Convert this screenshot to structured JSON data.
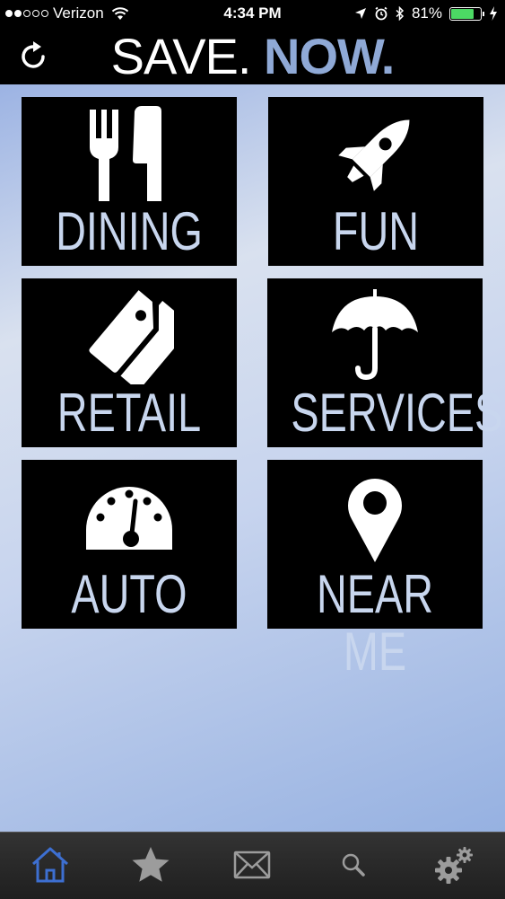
{
  "status_bar": {
    "carrier": "Verizon",
    "time": "4:34 PM",
    "battery_percent": "81%",
    "battery_level": 0.81,
    "signal_bars": 2
  },
  "header": {
    "brand_part1": "SAVE.",
    "brand_part2": "NOW."
  },
  "tiles": [
    {
      "label": "DINING",
      "icon": "fork-knife-icon"
    },
    {
      "label": "FUN",
      "icon": "rocket-icon"
    },
    {
      "label": "RETAIL",
      "icon": "price-tags-icon"
    },
    {
      "label": "SERVICES",
      "icon": "umbrella-icon"
    },
    {
      "label": "AUTO",
      "icon": "speedometer-icon"
    },
    {
      "label": "NEAR ME",
      "icon": "map-pin-icon"
    }
  ],
  "tab_bar": {
    "items": [
      "home-icon",
      "star-icon",
      "mail-icon",
      "search-icon",
      "gears-icon"
    ],
    "active": "home-icon"
  },
  "colors": {
    "accent": "#8fa9d6",
    "tile_label": "#c8d6ee",
    "active_tab": "#3d6fd1"
  }
}
